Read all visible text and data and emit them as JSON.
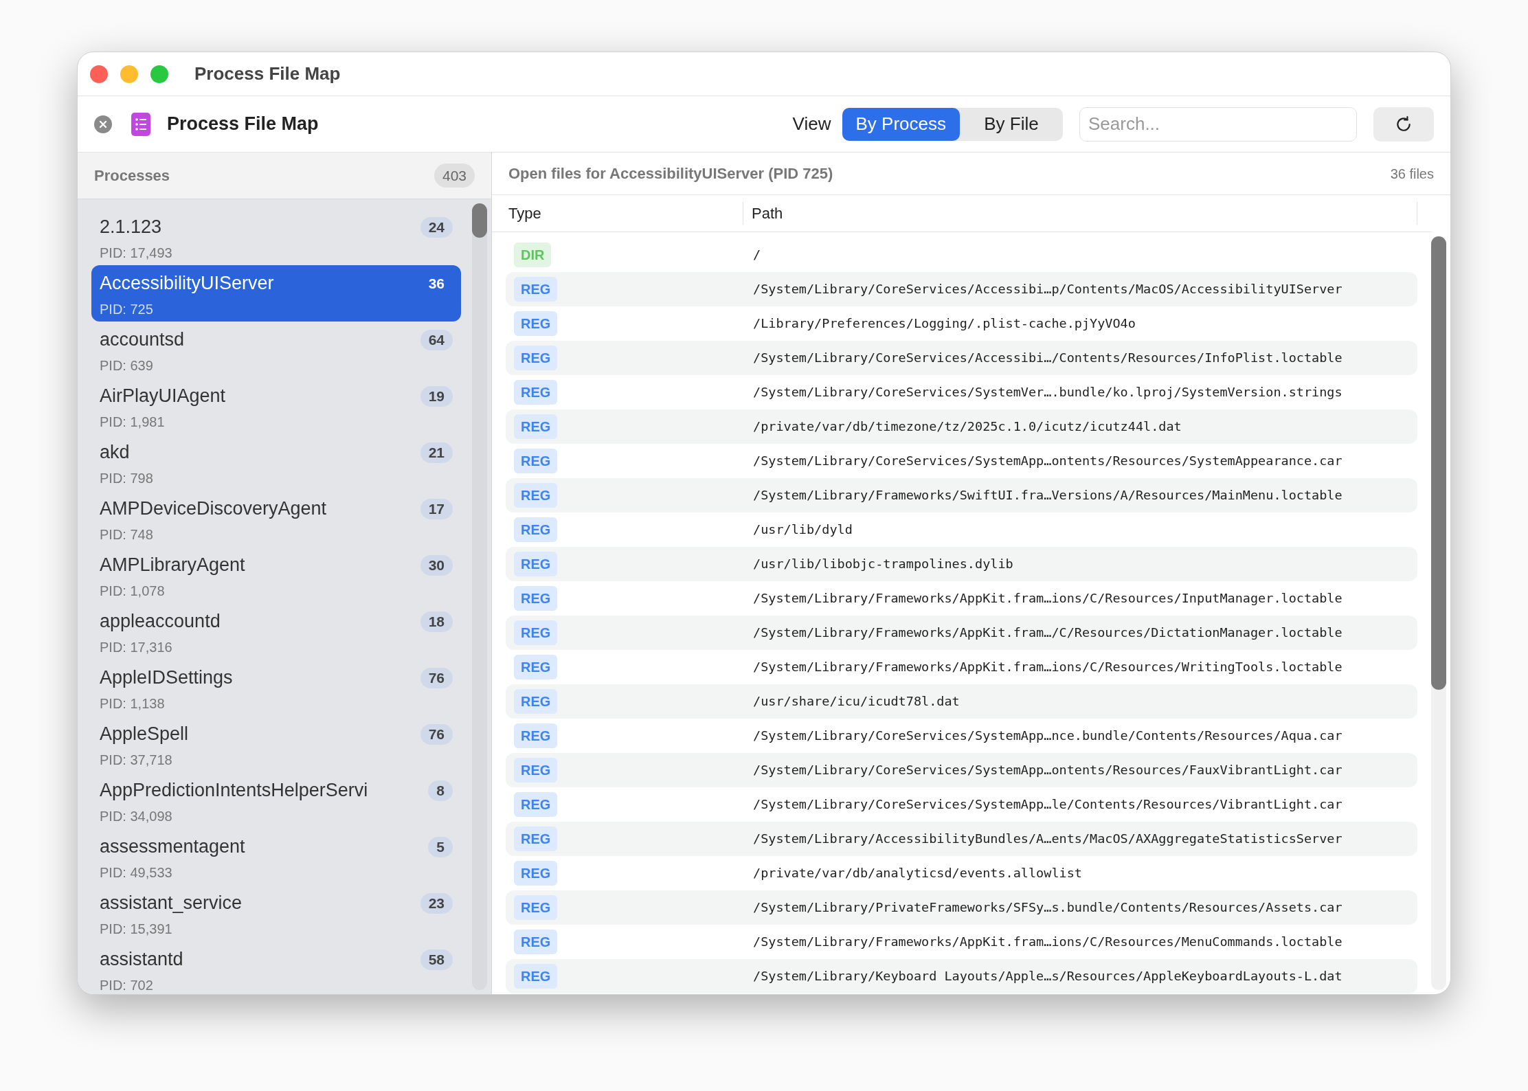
{
  "window": {
    "title": "Process File Map"
  },
  "toolbar": {
    "title": "Process File Map",
    "view_label": "View",
    "view_options": [
      {
        "label": "By Process",
        "selected": true
      },
      {
        "label": "By File",
        "selected": false
      }
    ],
    "search": {
      "placeholder": "Search..."
    }
  },
  "sidebar": {
    "title": "Processes",
    "count": "403",
    "items": [
      {
        "name": "2.1.123",
        "pid": "PID: 17,493",
        "count": "24",
        "selected": false
      },
      {
        "name": "AccessibilityUIServer",
        "pid": "PID: 725",
        "count": "36",
        "selected": true
      },
      {
        "name": "accountsd",
        "pid": "PID: 639",
        "count": "64",
        "selected": false
      },
      {
        "name": "AirPlayUIAgent",
        "pid": "PID: 1,981",
        "count": "19",
        "selected": false
      },
      {
        "name": "akd",
        "pid": "PID: 798",
        "count": "21",
        "selected": false
      },
      {
        "name": "AMPDeviceDiscoveryAgent",
        "pid": "PID: 748",
        "count": "17",
        "selected": false
      },
      {
        "name": "AMPLibraryAgent",
        "pid": "PID: 1,078",
        "count": "30",
        "selected": false
      },
      {
        "name": "appleaccountd",
        "pid": "PID: 17,316",
        "count": "18",
        "selected": false
      },
      {
        "name": "AppleIDSettings",
        "pid": "PID: 1,138",
        "count": "76",
        "selected": false
      },
      {
        "name": "AppleSpell",
        "pid": "PID: 37,718",
        "count": "76",
        "selected": false
      },
      {
        "name": "AppPredictionIntentsHelperServi",
        "pid": "PID: 34,098",
        "count": "8",
        "selected": false
      },
      {
        "name": "assessmentagent",
        "pid": "PID: 49,533",
        "count": "5",
        "selected": false
      },
      {
        "name": "assistant_service",
        "pid": "PID: 15,391",
        "count": "23",
        "selected": false
      },
      {
        "name": "assistantd",
        "pid": "PID: 702",
        "count": "58",
        "selected": false
      }
    ]
  },
  "detail": {
    "title": "Open files for AccessibilityUIServer (PID 725)",
    "count": "36 files",
    "table": {
      "columns": [
        "Type",
        "Path"
      ],
      "rows": [
        {
          "kind": "dir",
          "type": "DIR",
          "path": "/"
        },
        {
          "kind": "reg",
          "type": "REG",
          "path": "/System/Library/CoreServices/Accessibi…p/Contents/MacOS/AccessibilityUIServer"
        },
        {
          "kind": "reg",
          "type": "REG",
          "path": "/Library/Preferences/Logging/.plist-cache.pjYyVO4o"
        },
        {
          "kind": "reg",
          "type": "REG",
          "path": "/System/Library/CoreServices/Accessibi…/Contents/Resources/InfoPlist.loctable"
        },
        {
          "kind": "reg",
          "type": "REG",
          "path": "/System/Library/CoreServices/SystemVer….bundle/ko.lproj/SystemVersion.strings"
        },
        {
          "kind": "reg",
          "type": "REG",
          "path": "/private/var/db/timezone/tz/2025c.1.0/icutz/icutz44l.dat"
        },
        {
          "kind": "reg",
          "type": "REG",
          "path": "/System/Library/CoreServices/SystemApp…ontents/Resources/SystemAppearance.car"
        },
        {
          "kind": "reg",
          "type": "REG",
          "path": "/System/Library/Frameworks/SwiftUI.fra…Versions/A/Resources/MainMenu.loctable"
        },
        {
          "kind": "reg",
          "type": "REG",
          "path": "/usr/lib/dyld"
        },
        {
          "kind": "reg",
          "type": "REG",
          "path": "/usr/lib/libobjc-trampolines.dylib"
        },
        {
          "kind": "reg",
          "type": "REG",
          "path": "/System/Library/Frameworks/AppKit.fram…ions/C/Resources/InputManager.loctable"
        },
        {
          "kind": "reg",
          "type": "REG",
          "path": "/System/Library/Frameworks/AppKit.fram…/C/Resources/DictationManager.loctable"
        },
        {
          "kind": "reg",
          "type": "REG",
          "path": "/System/Library/Frameworks/AppKit.fram…ions/C/Resources/WritingTools.loctable"
        },
        {
          "kind": "reg",
          "type": "REG",
          "path": "/usr/share/icu/icudt78l.dat"
        },
        {
          "kind": "reg",
          "type": "REG",
          "path": "/System/Library/CoreServices/SystemApp…nce.bundle/Contents/Resources/Aqua.car"
        },
        {
          "kind": "reg",
          "type": "REG",
          "path": "/System/Library/CoreServices/SystemApp…ontents/Resources/FauxVibrantLight.car"
        },
        {
          "kind": "reg",
          "type": "REG",
          "path": "/System/Library/CoreServices/SystemApp…le/Contents/Resources/VibrantLight.car"
        },
        {
          "kind": "reg",
          "type": "REG",
          "path": "/System/Library/AccessibilityBundles/A…ents/MacOS/AXAggregateStatisticsServer"
        },
        {
          "kind": "reg",
          "type": "REG",
          "path": "/private/var/db/analyticsd/events.allowlist"
        },
        {
          "kind": "reg",
          "type": "REG",
          "path": "/System/Library/PrivateFrameworks/SFSy…s.bundle/Contents/Resources/Assets.car"
        },
        {
          "kind": "reg",
          "type": "REG",
          "path": "/System/Library/Frameworks/AppKit.fram…ions/C/Resources/MenuCommands.loctable"
        },
        {
          "kind": "reg",
          "type": "REG",
          "path": "/System/Library/Keyboard Layouts/Apple…s/Resources/AppleKeyboardLayouts-L.dat"
        }
      ]
    }
  }
}
